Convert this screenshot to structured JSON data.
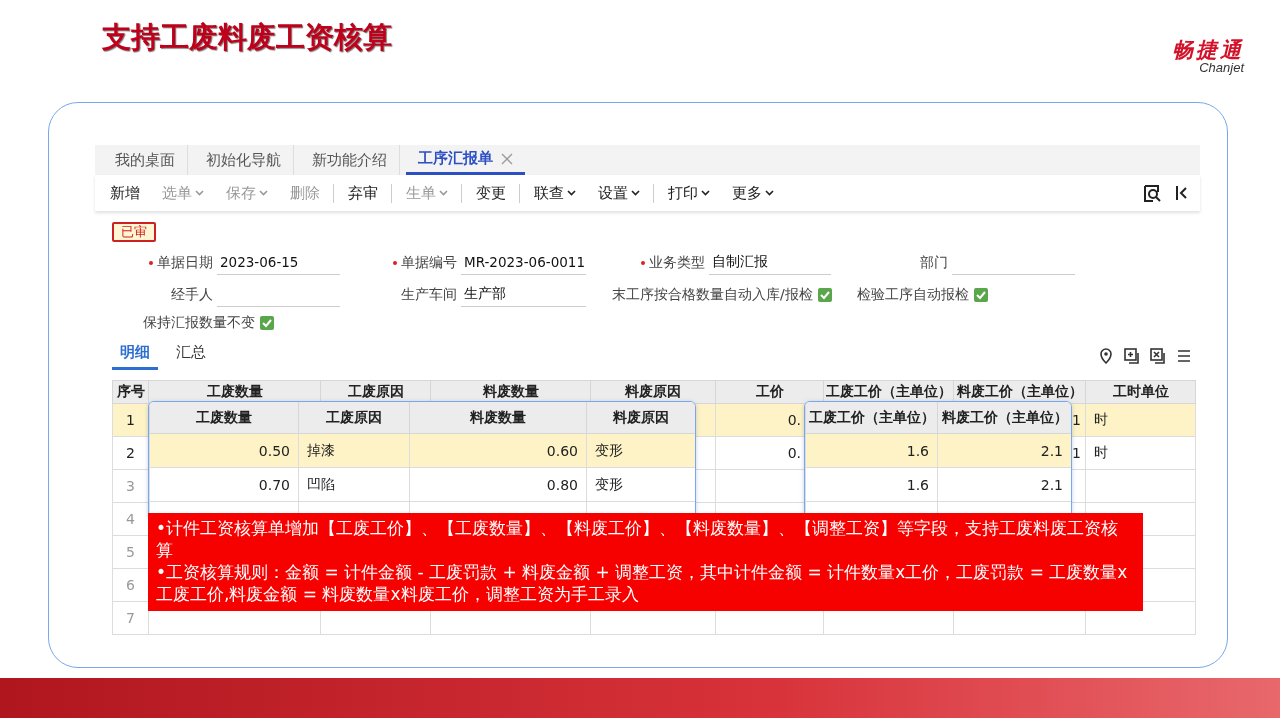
{
  "slide": {
    "title": "支持工废料废工资核算",
    "logo": {
      "name": "畅捷通",
      "sub": "Chanjet"
    }
  },
  "app": {
    "tabs": [
      {
        "label": "我的桌面",
        "selected": false,
        "closable": false
      },
      {
        "label": "初始化导航",
        "selected": false,
        "closable": false
      },
      {
        "label": "新功能介绍",
        "selected": false,
        "closable": false
      },
      {
        "label": "工序汇报单",
        "selected": true,
        "closable": true
      }
    ],
    "toolbar": [
      {
        "label": "新增",
        "disabled": false,
        "dropdown": false,
        "separator": false
      },
      {
        "label": "选单",
        "disabled": true,
        "dropdown": true,
        "separator": false
      },
      {
        "label": "保存",
        "disabled": true,
        "dropdown": true,
        "separator": false
      },
      {
        "label": "删除",
        "disabled": true,
        "dropdown": false,
        "separator": false
      },
      {
        "label": "弃审",
        "disabled": false,
        "dropdown": false,
        "separator": true
      },
      {
        "label": "生单",
        "disabled": true,
        "dropdown": true,
        "separator": true
      },
      {
        "label": "变更",
        "disabled": false,
        "dropdown": false,
        "separator": true
      },
      {
        "label": "联查",
        "disabled": false,
        "dropdown": true,
        "separator": true
      },
      {
        "label": "设置",
        "disabled": false,
        "dropdown": true,
        "separator": false
      },
      {
        "label": "打印",
        "disabled": false,
        "dropdown": true,
        "separator": true
      },
      {
        "label": "更多",
        "disabled": false,
        "dropdown": true,
        "separator": false
      }
    ],
    "status": "已审",
    "form_rows": [
      [
        {
          "kind": "field",
          "label": "单据日期",
          "required": true,
          "value": "2023-06-15"
        },
        {
          "kind": "field",
          "label": "单据编号",
          "required": true,
          "value": "MR-2023-06-0011"
        },
        {
          "kind": "field",
          "label": "业务类型",
          "required": true,
          "value": "自制汇报"
        },
        {
          "kind": "field",
          "label": "部门",
          "required": false
        }
      ],
      [
        {
          "kind": "field",
          "label": "经手人",
          "required": false
        },
        {
          "kind": "field",
          "label": "生产车间",
          "required": false,
          "value": "生产部"
        },
        {
          "kind": "checkbox",
          "label": "末工序按合格数量自动入库/报检",
          "checked": true
        },
        {
          "kind": "checkbox",
          "label": "检验工序自动报检",
          "checked": true
        }
      ],
      [
        {
          "kind": "checkbox",
          "label": "保持汇报数量不变",
          "checked": true
        }
      ]
    ],
    "sub_tabs": [
      {
        "label": "明细",
        "selected": true
      },
      {
        "label": "汇总",
        "selected": false
      }
    ],
    "table": {
      "columns": [
        "序号",
        "工废数量",
        "工废原因",
        "料废数量",
        "料废原因",
        "工价",
        "工废工价（主单位）",
        "料废工价（主单位）",
        "工时单位"
      ],
      "rows": [
        {
          "selected": true,
          "empty": false,
          "cells": [
            "1",
            null,
            null,
            null,
            null,
            "0.",
            null,
            "1",
            "时"
          ]
        },
        {
          "selected": false,
          "empty": false,
          "cells": [
            "2",
            null,
            null,
            null,
            null,
            "0.",
            null,
            "1",
            "时"
          ]
        },
        {
          "selected": false,
          "empty": true,
          "cells": [
            "3"
          ]
        },
        {
          "selected": false,
          "empty": true,
          "cells": [
            "4"
          ]
        },
        {
          "selected": false,
          "empty": true,
          "cells": [
            "5"
          ]
        },
        {
          "selected": false,
          "empty": true,
          "cells": [
            "6"
          ]
        },
        {
          "selected": false,
          "empty": true,
          "cells": [
            "7"
          ]
        }
      ]
    },
    "zoom_left": {
      "columns": [
        "工废数量",
        "工废原因",
        "料废数量",
        "料废原因"
      ],
      "rows": [
        {
          "selected": true,
          "cells": [
            "0.50",
            "掉漆",
            "0.60",
            "变形"
          ]
        },
        {
          "selected": false,
          "cells": [
            "0.70",
            "凹陷",
            "0.80",
            "变形"
          ]
        }
      ]
    },
    "zoom_right": {
      "columns": [
        "工废工价（主单位）",
        "料废工价（主单位）"
      ],
      "rows": [
        {
          "selected": true,
          "cells": [
            "1.6",
            "2.1"
          ]
        },
        {
          "selected": false,
          "cells": [
            "1.6",
            "2.1"
          ]
        }
      ]
    }
  },
  "callout": [
    "•计件工资核算单增加【工废工价】、【工废数量】、【料废工价】、【料废数量】、【调整工资】等字段，支持工废料废工资核算",
    "•工资核算规则：金额 = 计件金额 - 工废罚款 + 料废金额 + 调整工资，其中计件金额 = 计件数量x工价，工废罚款 = 工废数量x工废工价,料废金额 = 料废数量x料废工价，调整工资为手工录入"
  ]
}
